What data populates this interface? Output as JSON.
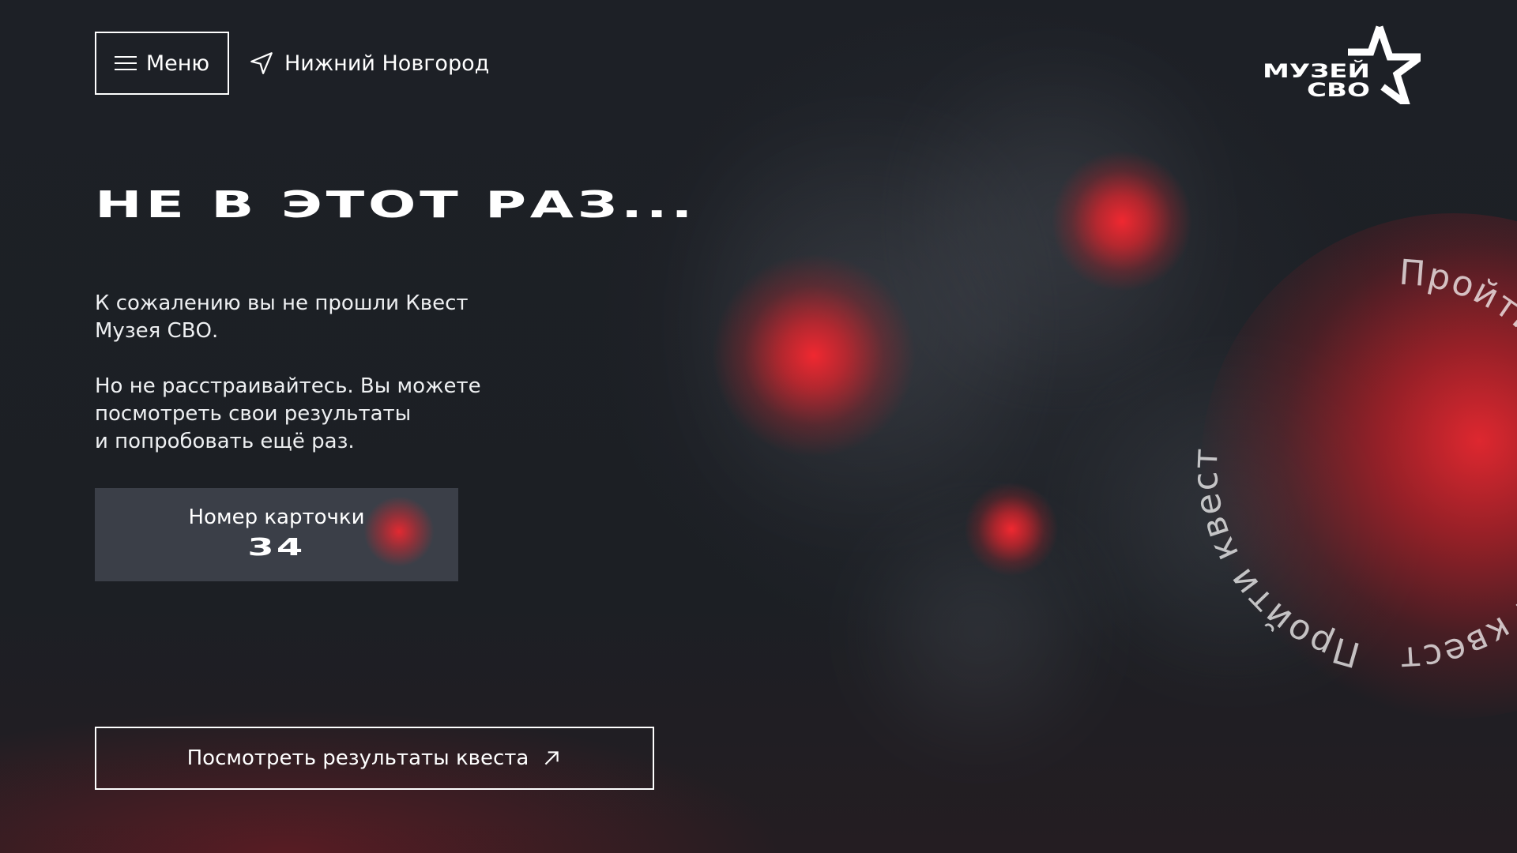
{
  "header": {
    "menu_label": "Меню",
    "location": "Нижний Новгород",
    "logo_line1": "МУЗЕЙ",
    "logo_line2": "СВО"
  },
  "main": {
    "title": "НЕ В ЭТОТ РАЗ...",
    "paragraph1": "К сожалению вы не прошли Квест\nМузея СВО.",
    "paragraph2": "Но не расстраивайтесь. Вы можете\nпосмотреть свои результаты\nи попробовать ещё раз.",
    "card_label": "Номер карточки",
    "card_number": "34",
    "results_button": "Посмотреть результаты квеста"
  },
  "quest_ring": {
    "label": "Пройти квест"
  },
  "colors": {
    "background": "#1c1f25",
    "accent_red": "#e8282f",
    "text": "#ffffff"
  }
}
